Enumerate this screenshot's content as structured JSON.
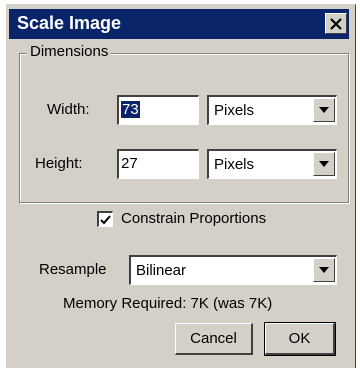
{
  "window": {
    "title": "Scale Image",
    "close_icon": "close-icon"
  },
  "dimensions": {
    "group_label": "Dimensions",
    "width_label": "Width:",
    "width_value": "73",
    "width_unit": "Pixels",
    "height_label": "Height:",
    "height_value": "27",
    "height_unit": "Pixels"
  },
  "constrain": {
    "label": "Constrain Proportions",
    "checked": true
  },
  "resample": {
    "label": "Resample",
    "value": "Bilinear"
  },
  "memory": {
    "text": "Memory Required: 7K (was 7K)"
  },
  "buttons": {
    "cancel": "Cancel",
    "ok": "OK"
  },
  "colors": {
    "titlebar": "#0a246a",
    "face": "#d4d0c8"
  }
}
